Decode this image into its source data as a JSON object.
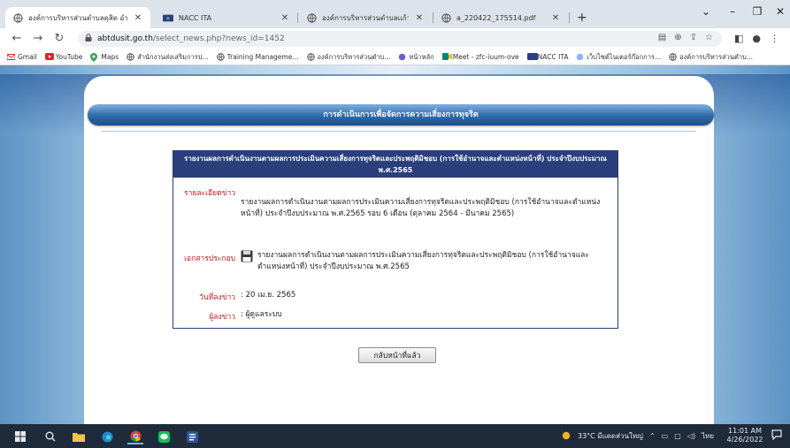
{
  "browser": {
    "tabs": [
      {
        "title": "องค์การบริหารส่วนตำบลดุสิต อำเภอเ",
        "active": true
      },
      {
        "title": "NACC ITA",
        "active": false
      },
      {
        "title": "องค์การบริหารส่วนตำบลแก้วแสน อำเภ",
        "active": false
      },
      {
        "title": "a_220422_175514.pdf",
        "active": false
      }
    ],
    "tab_close": "✕",
    "new_tab": "+",
    "window_controls": {
      "dropdown": "⌄",
      "minimize": "–",
      "maximize": "❐",
      "close": "✕"
    },
    "nav": {
      "back": "←",
      "forward": "→",
      "reload": "↻"
    },
    "url": {
      "host": "abtdusit.go.th",
      "path": "/select_news.php?news_id=1452"
    },
    "bookmarks": [
      {
        "label": "Gmail",
        "icon": "gmail-icon"
      },
      {
        "label": "YouTube",
        "icon": "youtube-icon"
      },
      {
        "label": "Maps",
        "icon": "maps-icon"
      },
      {
        "label": "สำนักงานส่งเสริมการป...",
        "icon": "globe-icon"
      },
      {
        "label": "Training Manageme...",
        "icon": "globe-icon"
      },
      {
        "label": "องค์การบริหารส่วนตำบ...",
        "icon": "globe-icon"
      },
      {
        "label": "หน้าหลัก",
        "icon": "globe-icon"
      },
      {
        "label": "Meet - zfc-iuum-ove",
        "icon": "meet-icon"
      },
      {
        "label": "NACC ITA",
        "icon": "nacc-icon"
      },
      {
        "label": "เว็บไซต์ไนเตอร์ก๊อกการ...",
        "icon": "globe-icon"
      },
      {
        "label": "องค์การบริหารส่วนตำบ...",
        "icon": "globe-icon"
      }
    ]
  },
  "page": {
    "header_title": "การดำเนินการเพื่อจัดการความเสี่ยงการทุจริต",
    "card_title": "รายงานผลการดำเนินงานตามผลการประเมินความเสี่ยงการทุจริตและประพฤติมิชอบ (การใช้อำนาจและตำแหน่งหน้าที่) ประจำปีงบประมาณ พ.ศ.2565",
    "detail_label": "รายละเอียดข่าว",
    "detail_text": "รายงานผลการดำเนินงานตามผลการประเมินความเสี่ยงการทุจริตและประพฤติมิชอบ (การใช้อำนาจและตำแหน่งหน้าที่) ประจำปีงบประมาณ พ.ศ.2565 รอบ 6 เดือน (ตุลาคม 2564 - มีนาคม 2565)",
    "attachment_label": "เอกสารประกอบ",
    "attachment_text": "รายงานผลการดำเนินงานตามผลการประเมินความเสี่ยงการทุจริตและประพฤติมิชอบ (การใช้อำนาจและตำแหน่งหน้าที่) ประจำปีงบประมาณ พ.ศ.2565",
    "date_label": "วันที่ลงข่าว",
    "date_value": ": 20 เม.ย. 2565",
    "author_label": "ผู้ลงข่าว",
    "author_value": ": ผู้ดูแลระบบ",
    "back_button": "กลับหน้าที่แล้ว"
  },
  "taskbar": {
    "weather": "33°C มีแดดส่วนใหญ่",
    "time": "11:01 AM",
    "date": "4/26/2022"
  }
}
